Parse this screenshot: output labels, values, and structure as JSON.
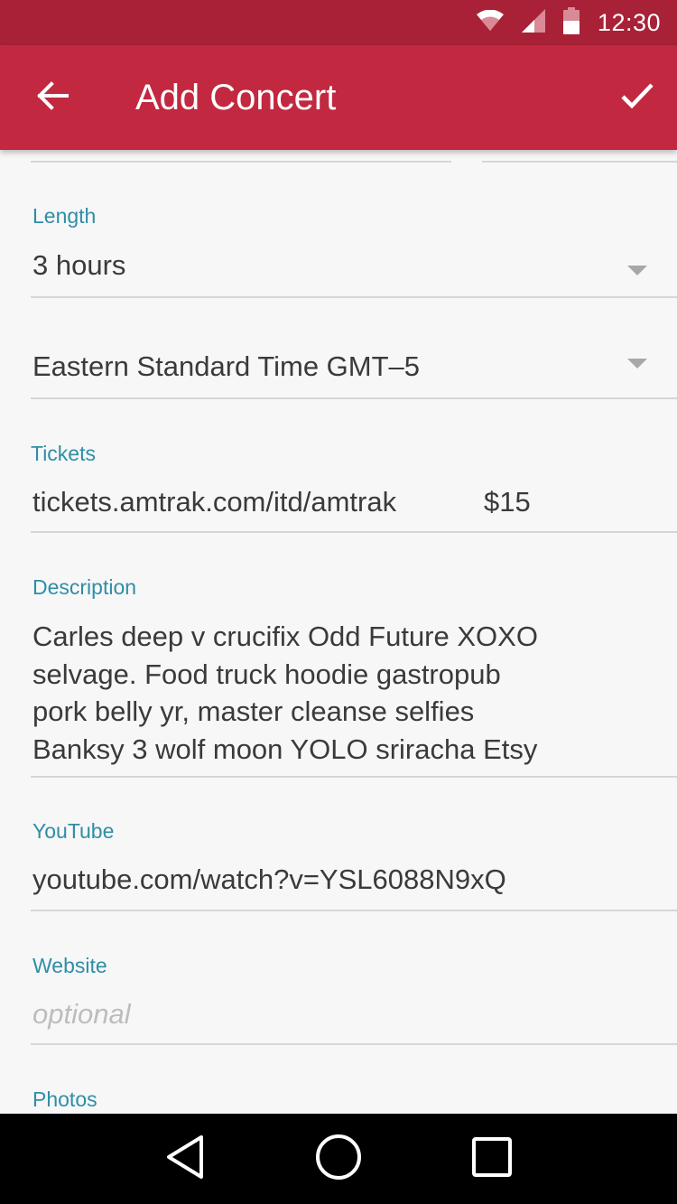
{
  "status_bar": {
    "time": "12:30"
  },
  "app_bar": {
    "title": "Add Concert"
  },
  "form": {
    "length": {
      "label": "Length",
      "value": "3 hours"
    },
    "timezone": {
      "value": "Eastern Standard Time  GMT–5"
    },
    "tickets": {
      "label": "Tickets",
      "url": "tickets.amtrak.com/itd/amtrak",
      "price": "$15"
    },
    "description": {
      "label": "Description",
      "lines": [
        "Carles deep v crucifix Odd Future XOXO",
        "selvage. Food truck hoodie gastropub",
        "pork belly yr, master cleanse selfies",
        "Banksy 3 wolf moon YOLO sriracha Etsy"
      ]
    },
    "youtube": {
      "label": "YouTube",
      "value": "youtube.com/watch?v=YSL6088N9xQ"
    },
    "website": {
      "label": "Website",
      "placeholder": "optional"
    },
    "photos": {
      "label": "Photos"
    }
  },
  "icons": {
    "wifi": "wifi-icon",
    "cell": "cell-signal-icon",
    "battery": "battery-icon",
    "back": "arrow-back-icon",
    "check": "check-icon",
    "nav_back": "nav-back-icon",
    "nav_home": "nav-home-icon",
    "nav_recents": "nav-recents-icon"
  },
  "colors": {
    "status_bar": "#a82136",
    "app_bar": "#c22840",
    "label": "#2f8ea6",
    "text": "#3a3a3a",
    "placeholder": "#bdbdbd"
  }
}
